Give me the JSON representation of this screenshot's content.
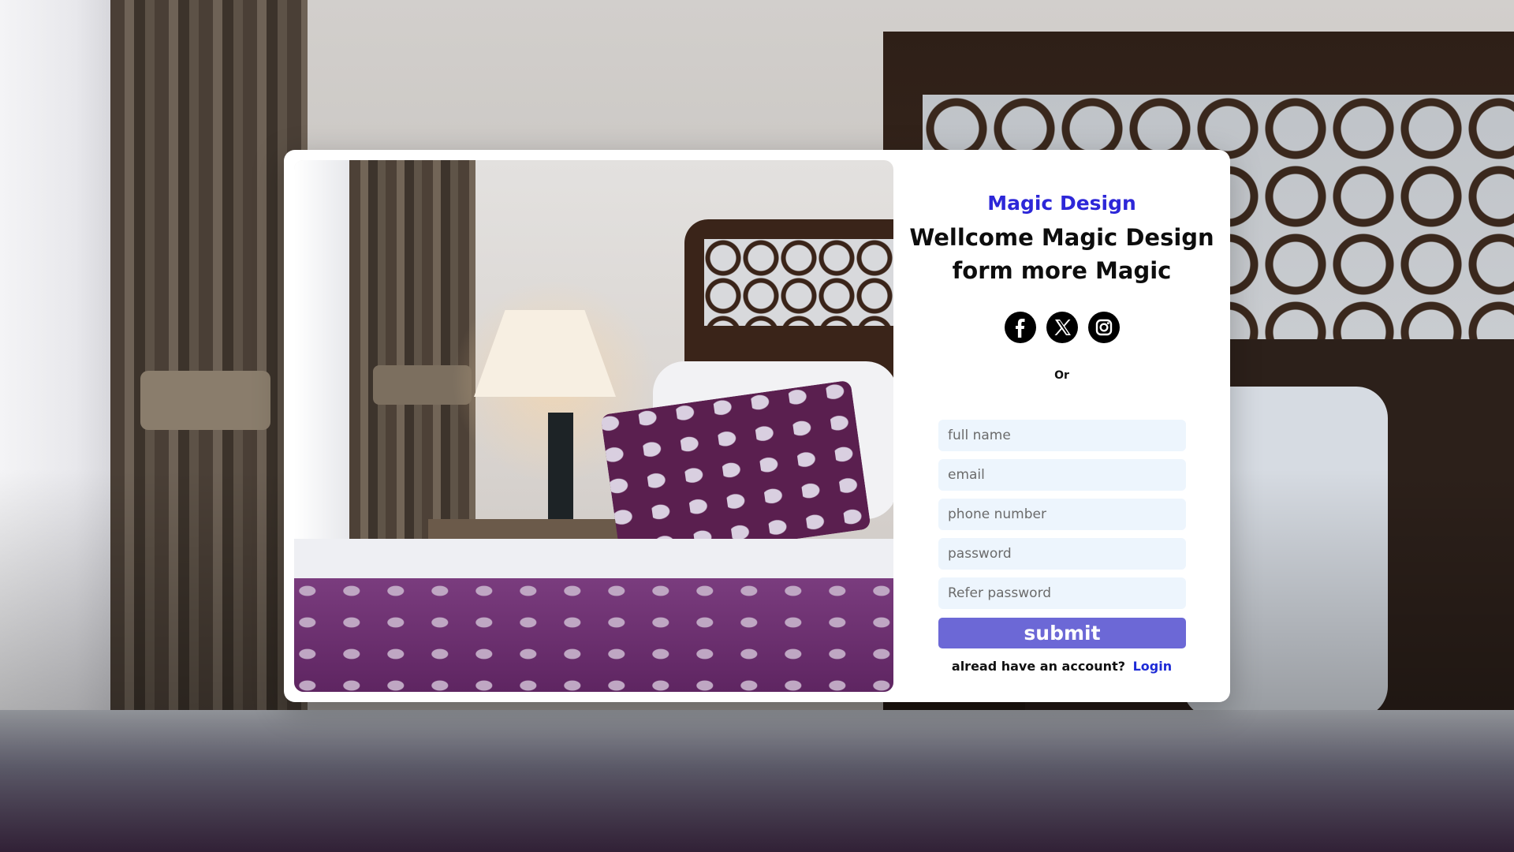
{
  "brand": "Magic Design",
  "welcome": {
    "line1": "Wellcome Magic Design",
    "line2": "form more Magic"
  },
  "socials": [
    {
      "icon": "facebook-icon"
    },
    {
      "icon": "x-icon"
    },
    {
      "icon": "instagram-icon"
    }
  ],
  "divider_text": "Or",
  "form": {
    "full_name_placeholder": "full name",
    "email_placeholder": "email",
    "phone_placeholder": "phone number",
    "password_placeholder": "password",
    "refer_password_placeholder": "Refer password",
    "submit_label": "submit"
  },
  "footer": {
    "prompt": "alread have an account?",
    "login_label": "Login"
  },
  "colors": {
    "brand": "#2d27d8",
    "submit_bg": "#6c68d6",
    "input_bg": "#edf5fd",
    "link": "#1e2bd6"
  }
}
